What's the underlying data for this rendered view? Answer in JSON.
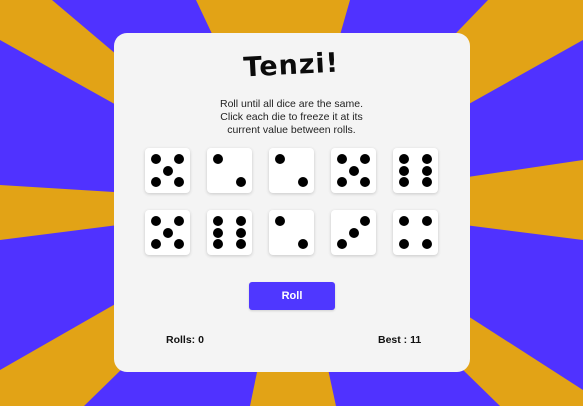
{
  "colors": {
    "background_gold": "#e2a316",
    "ray_blue": "#5032ff",
    "card": "#f4f4f4",
    "button": "#4f37ff",
    "pip": "#000000"
  },
  "title": "Tenzi!",
  "instructions": [
    "Roll until all dice are the same.",
    "Click each die to freeze it at its",
    "current value between rolls."
  ],
  "dice": [
    {
      "value": 5,
      "held": false
    },
    {
      "value": 2,
      "held": false
    },
    {
      "value": 2,
      "held": false
    },
    {
      "value": 5,
      "held": false
    },
    {
      "value": 6,
      "held": false
    },
    {
      "value": 5,
      "held": false
    },
    {
      "value": 6,
      "held": false
    },
    {
      "value": 2,
      "held": false
    },
    {
      "value": 3,
      "held": false
    },
    {
      "value": 4,
      "held": false
    }
  ],
  "roll_button": "Roll",
  "stats": {
    "rolls": "Rolls: 0",
    "best": "Best : 11"
  }
}
